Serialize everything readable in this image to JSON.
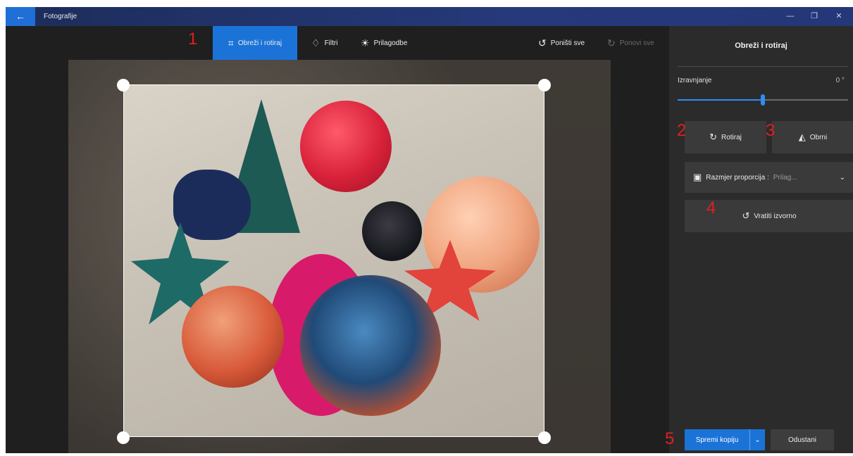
{
  "window": {
    "title": "Fotografije",
    "back_icon": "←",
    "minimize_icon": "—",
    "maximize_icon": "❐",
    "close_icon": "✕"
  },
  "toolbar": {
    "crop_label": "Obreži i rotiraj",
    "crop_icon": "⌗",
    "filters_label": "Filtri",
    "filters_icon": "♢",
    "adjust_label": "Prilagodbe",
    "adjust_icon": "☀",
    "undo_label": "Poništi sve",
    "undo_icon": "↺",
    "redo_label": "Ponovi sve",
    "redo_icon": "↻",
    "accent_color": "#1b73d8"
  },
  "markers": [
    "1",
    "2",
    "3",
    "4",
    "5"
  ],
  "panel": {
    "title": "Obreži i rotiraj",
    "straighten_label": "Izravnjanje",
    "straighten_value": "0 °",
    "straighten_fraction": 0.5,
    "rotate_label": "Rotiraj",
    "rotate_icon": "↻",
    "flip_label": "Obrni",
    "flip_icon": "◭",
    "aspect_label": "Razmjer proporcija : ",
    "aspect_value": "Prilag...",
    "aspect_icon": "▣",
    "aspect_chevron": "⌄",
    "reset_label": "Vratiti izvorno",
    "reset_icon": "↺",
    "save_label": "Spremi kopiju",
    "save_chevron": "⌄",
    "cancel_label": "Odustani"
  }
}
